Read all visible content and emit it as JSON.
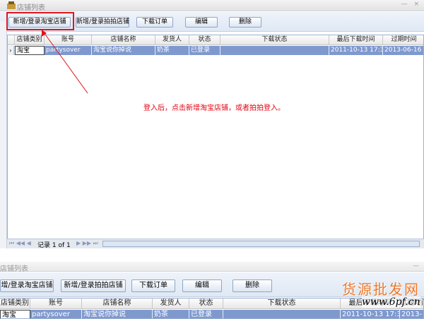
{
  "window": {
    "title": "店铺列表",
    "buttons": "— ×"
  },
  "toolbar": {
    "add_taobao": "新增/登录淘宝店铺",
    "add_paipai": "新增/登录拍拍店铺",
    "download_orders": "下载订单",
    "edit": "编辑",
    "delete": "删除"
  },
  "table": {
    "columns": [
      "店铺类别",
      "账号",
      "店铺名称",
      "发货人",
      "状态",
      "下载状态",
      "最后下载时间",
      "过期时间"
    ],
    "rows": [
      [
        "淘宝",
        "partysover",
        "淘宝说你掉说",
        "奶茶",
        "已登录",
        "",
        "2011-10-13 17:39",
        "2013-06-16"
      ]
    ]
  },
  "pager": {
    "nav_first": "⏮ ◀◀ ◀",
    "record_text": "记录 1 of 1",
    "nav_last": "▶ ▶▶ ⏭"
  },
  "annotation": {
    "text": "登入后，点击新增淘宝店铺，或者拍拍登入。"
  },
  "bottom_window": {
    "title": "店铺列表",
    "buttons": "—",
    "toolbar": {
      "add_taobao": "增/登录淘宝店铺",
      "add_paipai": "新增/登录拍拍店铺",
      "download_orders": "下载订单",
      "edit": "编辑",
      "delete": "删除"
    },
    "columns": [
      "店铺类别",
      "账号",
      "店铺名称",
      "发货人",
      "状态",
      "下载状态",
      "最后下载时间",
      "过期时间"
    ],
    "row": [
      "淘宝",
      "partysover",
      "淘宝说你掉说",
      "奶茶",
      "已登录",
      "",
      "2011-10-13 17:39",
      "2013-"
    ]
  },
  "watermark": {
    "text": "货源批发网",
    "url": "www.6pf.cn"
  },
  "colors": {
    "accent": "#e0141e",
    "selection": "#7f99cf",
    "watermark": "#f07828"
  }
}
